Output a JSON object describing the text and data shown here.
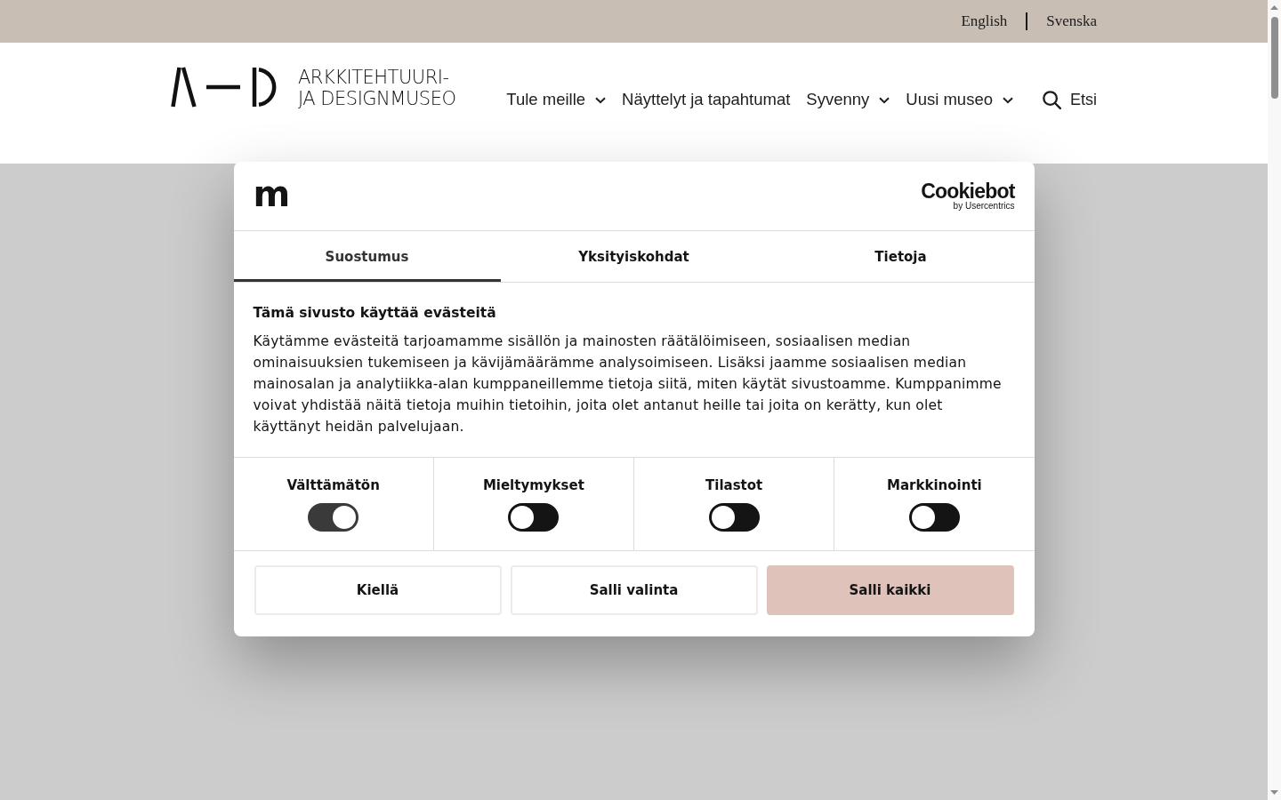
{
  "languages": [
    {
      "label": "English"
    },
    {
      "label": "Svenska"
    }
  ],
  "logo": {
    "lines": [
      "ARKKITEHTUURI-",
      "JA DESIGNMUSEO"
    ]
  },
  "nav": [
    {
      "label": "Tule meille",
      "has_menu": true
    },
    {
      "label": "Näyttelyt ja tapahtumat",
      "has_menu": false
    },
    {
      "label": "Syvenny",
      "has_menu": true
    },
    {
      "label": "Uusi museo",
      "has_menu": true
    }
  ],
  "search": {
    "label": "Etsi"
  },
  "consent_dialog": {
    "logo_text": "m",
    "provider": {
      "name": "Cookiebot",
      "tagline": "by Usercentrics"
    },
    "tabs": [
      {
        "label": "Suostumus",
        "selected": true
      },
      {
        "label": "Yksityiskohdat",
        "selected": false
      },
      {
        "label": "Tietoja",
        "selected": false
      }
    ],
    "title": "Tämä sivusto käyttää evästeitä",
    "text": "Käytämme evästeitä tarjoamamme sisällön ja mainosten räätälöimiseen, sosiaalisen median ominaisuuksien tukemiseen ja kävijämäärämme analysoimiseen. Lisäksi jaamme sosiaalisen median mainosalan ja analytiikka-alan kumppaneillemme tietoja siitä, miten käytät sivustoamme. Kumppanimme voivat yhdistää näitä tietoja muihin tietoihin, joita olet antanut heille tai joita on kerätty, kun olet käyttänyt heidän palvelujaan.",
    "categories": [
      {
        "label": "Välttämätön",
        "checked": true,
        "disabled": true
      },
      {
        "label": "Mieltymykset",
        "checked": false,
        "disabled": false
      },
      {
        "label": "Tilastot",
        "checked": false,
        "disabled": false
      },
      {
        "label": "Markkinointi",
        "checked": false,
        "disabled": false
      }
    ],
    "buttons": [
      {
        "label": "Kiellä",
        "kind": "outline"
      },
      {
        "label": "Salli valinta",
        "kind": "outline"
      },
      {
        "label": "Salli kaikki",
        "kind": "filled"
      }
    ]
  }
}
